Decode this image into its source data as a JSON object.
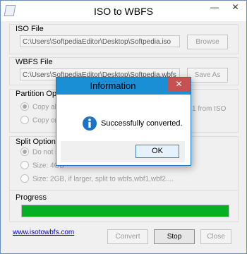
{
  "window": {
    "title": "ISO to WBFS",
    "minimize_glyph": "—",
    "close_glyph": "✕"
  },
  "iso_file": {
    "label": "ISO File",
    "value": "C:\\Users\\SoftpediaEditor\\Desktop\\Softpedia.iso",
    "button": "Browse"
  },
  "wbfs_file": {
    "label": "WBFS File",
    "value": "C:\\Users\\SoftpediaEditor\\Desktop\\Softpedia.wbfs",
    "button": "Save As"
  },
  "partition_options": {
    "label": "Partition Options",
    "options": [
      {
        "label_left": "Copy all pa",
        "label_right": "1 from ISO",
        "checked": true
      },
      {
        "label_left": "Copy only",
        "label_right": "",
        "checked": false
      }
    ]
  },
  "split_options": {
    "label": "Split Options",
    "options": [
      {
        "label": "Do not spl",
        "checked": true
      },
      {
        "label": "Size: 4GB",
        "checked": false
      },
      {
        "label": "Size: 2GB, if larger, split to wbfs,wbf1,wbf2....",
        "checked": false
      }
    ]
  },
  "progress": {
    "label": "Progress",
    "value_fraction": 1.0,
    "fill_color": "#06b025"
  },
  "footer": {
    "link": "www.isotowbfs.com",
    "convert": "Convert",
    "stop": "Stop",
    "close": "Close"
  },
  "dialog": {
    "title": "Information",
    "close_glyph": "✕",
    "message": "Successfully converted.",
    "ok": "OK",
    "icon": "information-icon"
  },
  "colors": {
    "accent": "#1b8fd6",
    "close_red": "#c75050",
    "progress_green": "#06b025"
  }
}
